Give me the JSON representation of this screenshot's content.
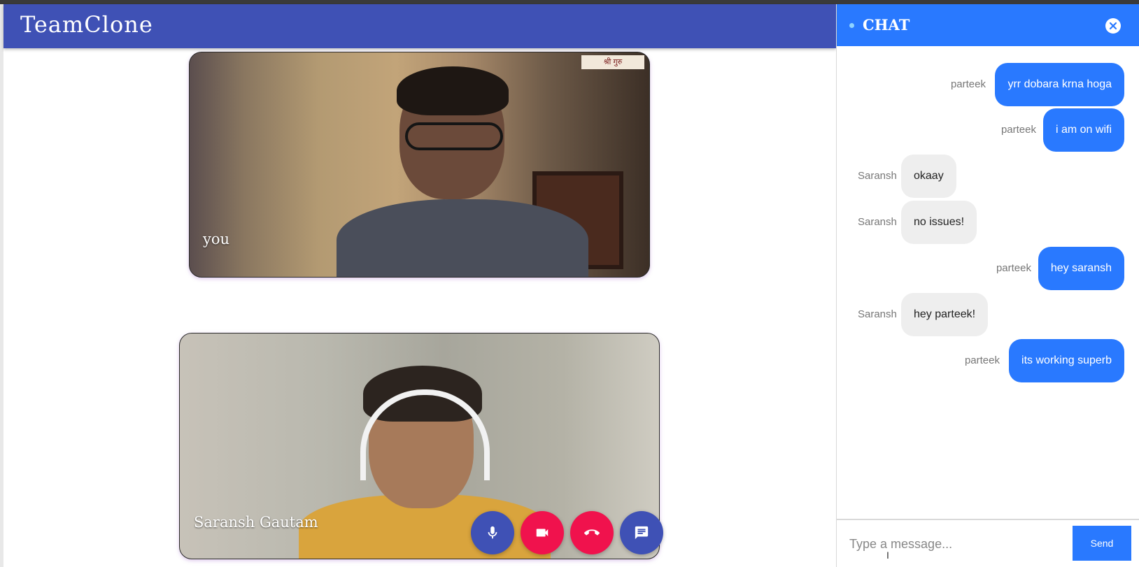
{
  "app": {
    "brand": "TeamClone"
  },
  "videos": {
    "local": {
      "label": "you",
      "sign_text": "श्री गुरु"
    },
    "remote": {
      "label": "Saransh Gautam"
    }
  },
  "controls": [
    {
      "name": "mic-button",
      "icon": "mic-icon"
    },
    {
      "name": "camera-button",
      "icon": "video-camera-icon"
    },
    {
      "name": "end-call-button",
      "icon": "phone-hangup-icon"
    },
    {
      "name": "chat-toggle-button",
      "icon": "chat-icon"
    }
  ],
  "chat": {
    "title": "CHAT",
    "messages": [
      {
        "sender": "parteek",
        "text": "yrr dobara krna hoga",
        "direction": "out"
      },
      {
        "sender": "parteek",
        "text": "i am on wifi",
        "direction": "out"
      },
      {
        "sender": "Saransh",
        "text": "okaay",
        "direction": "in"
      },
      {
        "sender": "Saransh",
        "text": "no issues!",
        "direction": "in"
      },
      {
        "sender": "parteek",
        "text": "hey saransh",
        "direction": "out"
      },
      {
        "sender": "Saransh",
        "text": "hey parteek!",
        "direction": "in"
      },
      {
        "sender": "parteek",
        "text": "its working superb",
        "direction": "out"
      }
    ],
    "input_placeholder": "Type a message...",
    "send_label": "Send"
  },
  "colors": {
    "header": "#3f51b5",
    "chat_accent": "#2979ff",
    "danger": "#f0124d"
  }
}
